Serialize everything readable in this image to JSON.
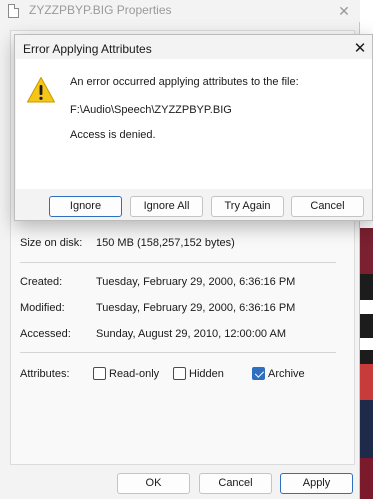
{
  "properties_window": {
    "title": "ZYZZPBYP.BIG Properties",
    "close_glyph": "✕",
    "size_on_disk": {
      "label": "Size on disk:",
      "value": "150 MB (158,257,152 bytes)"
    },
    "created": {
      "label": "Created:",
      "value": "Tuesday, February 29, 2000, 6:36:16 PM"
    },
    "modified": {
      "label": "Modified:",
      "value": "Tuesday, February 29, 2000, 6:36:16 PM"
    },
    "accessed": {
      "label": "Accessed:",
      "value": "Sunday, August 29, 2010, 12:00:00 AM"
    },
    "attributes": {
      "label": "Attributes:",
      "read_only": {
        "label": "Read-only",
        "checked": false
      },
      "hidden": {
        "label": "Hidden",
        "checked": false
      },
      "archive": {
        "label": "Archive",
        "checked": true
      }
    },
    "buttons": {
      "ok": "OK",
      "cancel": "Cancel",
      "apply": "Apply"
    }
  },
  "error_dialog": {
    "title": "Error Applying Attributes",
    "close_glyph": "✕",
    "icon": "warning-icon",
    "message_line1": "An error occurred applying attributes to the file:",
    "path": "F:\\Audio\\Speech\\ZYZZPBYP.BIG",
    "message_line3": "Access is denied.",
    "buttons": {
      "ignore": "Ignore",
      "ignore_all": "Ignore All",
      "try_again": "Try Again",
      "cancel": "Cancel"
    }
  },
  "colors": {
    "accent": "#2f6fbf",
    "warning": "#f5c518"
  }
}
